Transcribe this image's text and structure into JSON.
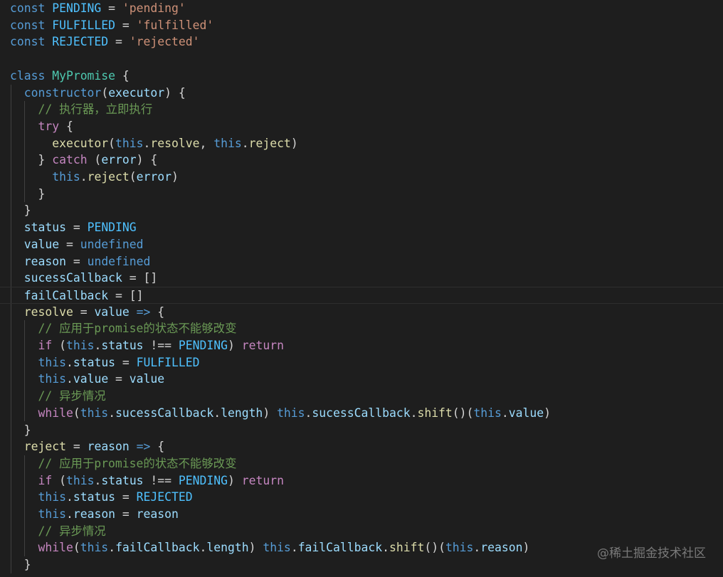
{
  "editor": {
    "theme": "dark",
    "colors": {
      "background": "#1e1e1e",
      "keyword": "#569cd6",
      "control": "#c586c0",
      "class_name": "#4ec9b0",
      "function": "#dcdcaa",
      "variable": "#9cdcfe",
      "constant": "#4fc1ff",
      "string": "#ce9178",
      "comment": "#6a9955",
      "plain": "#d4d4d4"
    },
    "lines": [
      [
        [
          "kw",
          "const"
        ],
        [
          "pun",
          " "
        ],
        [
          "cst",
          "PENDING"
        ],
        [
          "pun",
          " = "
        ],
        [
          "str",
          "'pending'"
        ]
      ],
      [
        [
          "kw",
          "const"
        ],
        [
          "pun",
          " "
        ],
        [
          "cst",
          "FULFILLED"
        ],
        [
          "pun",
          " = "
        ],
        [
          "str",
          "'fulfilled'"
        ]
      ],
      [
        [
          "kw",
          "const"
        ],
        [
          "pun",
          " "
        ],
        [
          "cst",
          "REJECTED"
        ],
        [
          "pun",
          " = "
        ],
        [
          "str",
          "'rejected'"
        ]
      ],
      [],
      [
        [
          "kw",
          "class"
        ],
        [
          "pun",
          " "
        ],
        [
          "cls",
          "MyPromise"
        ],
        [
          "pun",
          " {"
        ]
      ],
      [
        [
          "pun",
          "  "
        ],
        [
          "kw",
          "constructor"
        ],
        [
          "pun",
          "("
        ],
        [
          "var",
          "executor"
        ],
        [
          "pun",
          ") {"
        ]
      ],
      [
        [
          "pun",
          "    "
        ],
        [
          "cmt",
          "// 执行器，立即执行"
        ]
      ],
      [
        [
          "pun",
          "    "
        ],
        [
          "ctl",
          "try"
        ],
        [
          "pun",
          " {"
        ]
      ],
      [
        [
          "pun",
          "      "
        ],
        [
          "fn",
          "executor"
        ],
        [
          "pun",
          "("
        ],
        [
          "kw",
          "this"
        ],
        [
          "pun",
          "."
        ],
        [
          "fn",
          "resolve"
        ],
        [
          "pun",
          ", "
        ],
        [
          "kw",
          "this"
        ],
        [
          "pun",
          "."
        ],
        [
          "fn",
          "reject"
        ],
        [
          "pun",
          ")"
        ]
      ],
      [
        [
          "pun",
          "    } "
        ],
        [
          "ctl",
          "catch"
        ],
        [
          "pun",
          " ("
        ],
        [
          "var",
          "error"
        ],
        [
          "pun",
          ") {"
        ]
      ],
      [
        [
          "pun",
          "      "
        ],
        [
          "kw",
          "this"
        ],
        [
          "pun",
          "."
        ],
        [
          "fn",
          "reject"
        ],
        [
          "pun",
          "("
        ],
        [
          "var",
          "error"
        ],
        [
          "pun",
          ")"
        ]
      ],
      [
        [
          "pun",
          "    }"
        ]
      ],
      [
        [
          "pun",
          "  }"
        ]
      ],
      [
        [
          "pun",
          "  "
        ],
        [
          "var",
          "status"
        ],
        [
          "pun",
          " = "
        ],
        [
          "cst",
          "PENDING"
        ]
      ],
      [
        [
          "pun",
          "  "
        ],
        [
          "var",
          "value"
        ],
        [
          "pun",
          " = "
        ],
        [
          "kw",
          "undefined"
        ]
      ],
      [
        [
          "pun",
          "  "
        ],
        [
          "var",
          "reason"
        ],
        [
          "pun",
          " = "
        ],
        [
          "kw",
          "undefined"
        ]
      ],
      [
        [
          "pun",
          "  "
        ],
        [
          "var",
          "sucessCallback"
        ],
        [
          "pun",
          " = []"
        ]
      ],
      [
        [
          "pun",
          "  "
        ],
        [
          "var",
          "failCallback"
        ],
        [
          "pun",
          " = []"
        ]
      ],
      [
        [
          "pun",
          "  "
        ],
        [
          "fn",
          "resolve"
        ],
        [
          "pun",
          " = "
        ],
        [
          "var",
          "value"
        ],
        [
          "pun",
          " "
        ],
        [
          "kw",
          "=>"
        ],
        [
          "pun",
          " {"
        ]
      ],
      [
        [
          "pun",
          "    "
        ],
        [
          "cmt",
          "// 应用于promise的状态不能够改变"
        ]
      ],
      [
        [
          "pun",
          "    "
        ],
        [
          "ctl",
          "if"
        ],
        [
          "pun",
          " ("
        ],
        [
          "kw",
          "this"
        ],
        [
          "pun",
          "."
        ],
        [
          "var",
          "status"
        ],
        [
          "pun",
          " !== "
        ],
        [
          "cst",
          "PENDING"
        ],
        [
          "pun",
          ") "
        ],
        [
          "ctl",
          "return"
        ]
      ],
      [
        [
          "pun",
          "    "
        ],
        [
          "kw",
          "this"
        ],
        [
          "pun",
          "."
        ],
        [
          "var",
          "status"
        ],
        [
          "pun",
          " = "
        ],
        [
          "cst",
          "FULFILLED"
        ]
      ],
      [
        [
          "pun",
          "    "
        ],
        [
          "kw",
          "this"
        ],
        [
          "pun",
          "."
        ],
        [
          "var",
          "value"
        ],
        [
          "pun",
          " = "
        ],
        [
          "var",
          "value"
        ]
      ],
      [
        [
          "pun",
          "    "
        ],
        [
          "cmt",
          "// 异步情况"
        ]
      ],
      [
        [
          "pun",
          "    "
        ],
        [
          "ctl",
          "while"
        ],
        [
          "pun",
          "("
        ],
        [
          "kw",
          "this"
        ],
        [
          "pun",
          "."
        ],
        [
          "var",
          "sucessCallback"
        ],
        [
          "pun",
          "."
        ],
        [
          "var",
          "length"
        ],
        [
          "pun",
          ") "
        ],
        [
          "kw",
          "this"
        ],
        [
          "pun",
          "."
        ],
        [
          "var",
          "sucessCallback"
        ],
        [
          "pun",
          "."
        ],
        [
          "fn",
          "shift"
        ],
        [
          "pun",
          "()("
        ],
        [
          "kw",
          "this"
        ],
        [
          "pun",
          "."
        ],
        [
          "var",
          "value"
        ],
        [
          "pun",
          ")"
        ]
      ],
      [
        [
          "pun",
          "  }"
        ]
      ],
      [
        [
          "pun",
          "  "
        ],
        [
          "fn",
          "reject"
        ],
        [
          "pun",
          " = "
        ],
        [
          "var",
          "reason"
        ],
        [
          "pun",
          " "
        ],
        [
          "kw",
          "=>"
        ],
        [
          "pun",
          " {"
        ]
      ],
      [
        [
          "pun",
          "    "
        ],
        [
          "cmt",
          "// 应用于promise的状态不能够改变"
        ]
      ],
      [
        [
          "pun",
          "    "
        ],
        [
          "ctl",
          "if"
        ],
        [
          "pun",
          " ("
        ],
        [
          "kw",
          "this"
        ],
        [
          "pun",
          "."
        ],
        [
          "var",
          "status"
        ],
        [
          "pun",
          " !== "
        ],
        [
          "cst",
          "PENDING"
        ],
        [
          "pun",
          ") "
        ],
        [
          "ctl",
          "return"
        ]
      ],
      [
        [
          "pun",
          "    "
        ],
        [
          "kw",
          "this"
        ],
        [
          "pun",
          "."
        ],
        [
          "var",
          "status"
        ],
        [
          "pun",
          " = "
        ],
        [
          "cst",
          "REJECTED"
        ]
      ],
      [
        [
          "pun",
          "    "
        ],
        [
          "kw",
          "this"
        ],
        [
          "pun",
          "."
        ],
        [
          "var",
          "reason"
        ],
        [
          "pun",
          " = "
        ],
        [
          "var",
          "reason"
        ]
      ],
      [
        [
          "pun",
          "    "
        ],
        [
          "cmt",
          "// 异步情况"
        ]
      ],
      [
        [
          "pun",
          "    "
        ],
        [
          "ctl",
          "while"
        ],
        [
          "pun",
          "("
        ],
        [
          "kw",
          "this"
        ],
        [
          "pun",
          "."
        ],
        [
          "var",
          "failCallback"
        ],
        [
          "pun",
          "."
        ],
        [
          "var",
          "length"
        ],
        [
          "pun",
          ") "
        ],
        [
          "kw",
          "this"
        ],
        [
          "pun",
          "."
        ],
        [
          "var",
          "failCallback"
        ],
        [
          "pun",
          "."
        ],
        [
          "fn",
          "shift"
        ],
        [
          "pun",
          "()("
        ],
        [
          "kw",
          "this"
        ],
        [
          "pun",
          "."
        ],
        [
          "var",
          "reason"
        ],
        [
          "pun",
          ")"
        ]
      ],
      [
        [
          "pun",
          "  }"
        ]
      ]
    ],
    "current_line": 17
  },
  "watermark": {
    "text": "@稀土掘金技术社区"
  }
}
